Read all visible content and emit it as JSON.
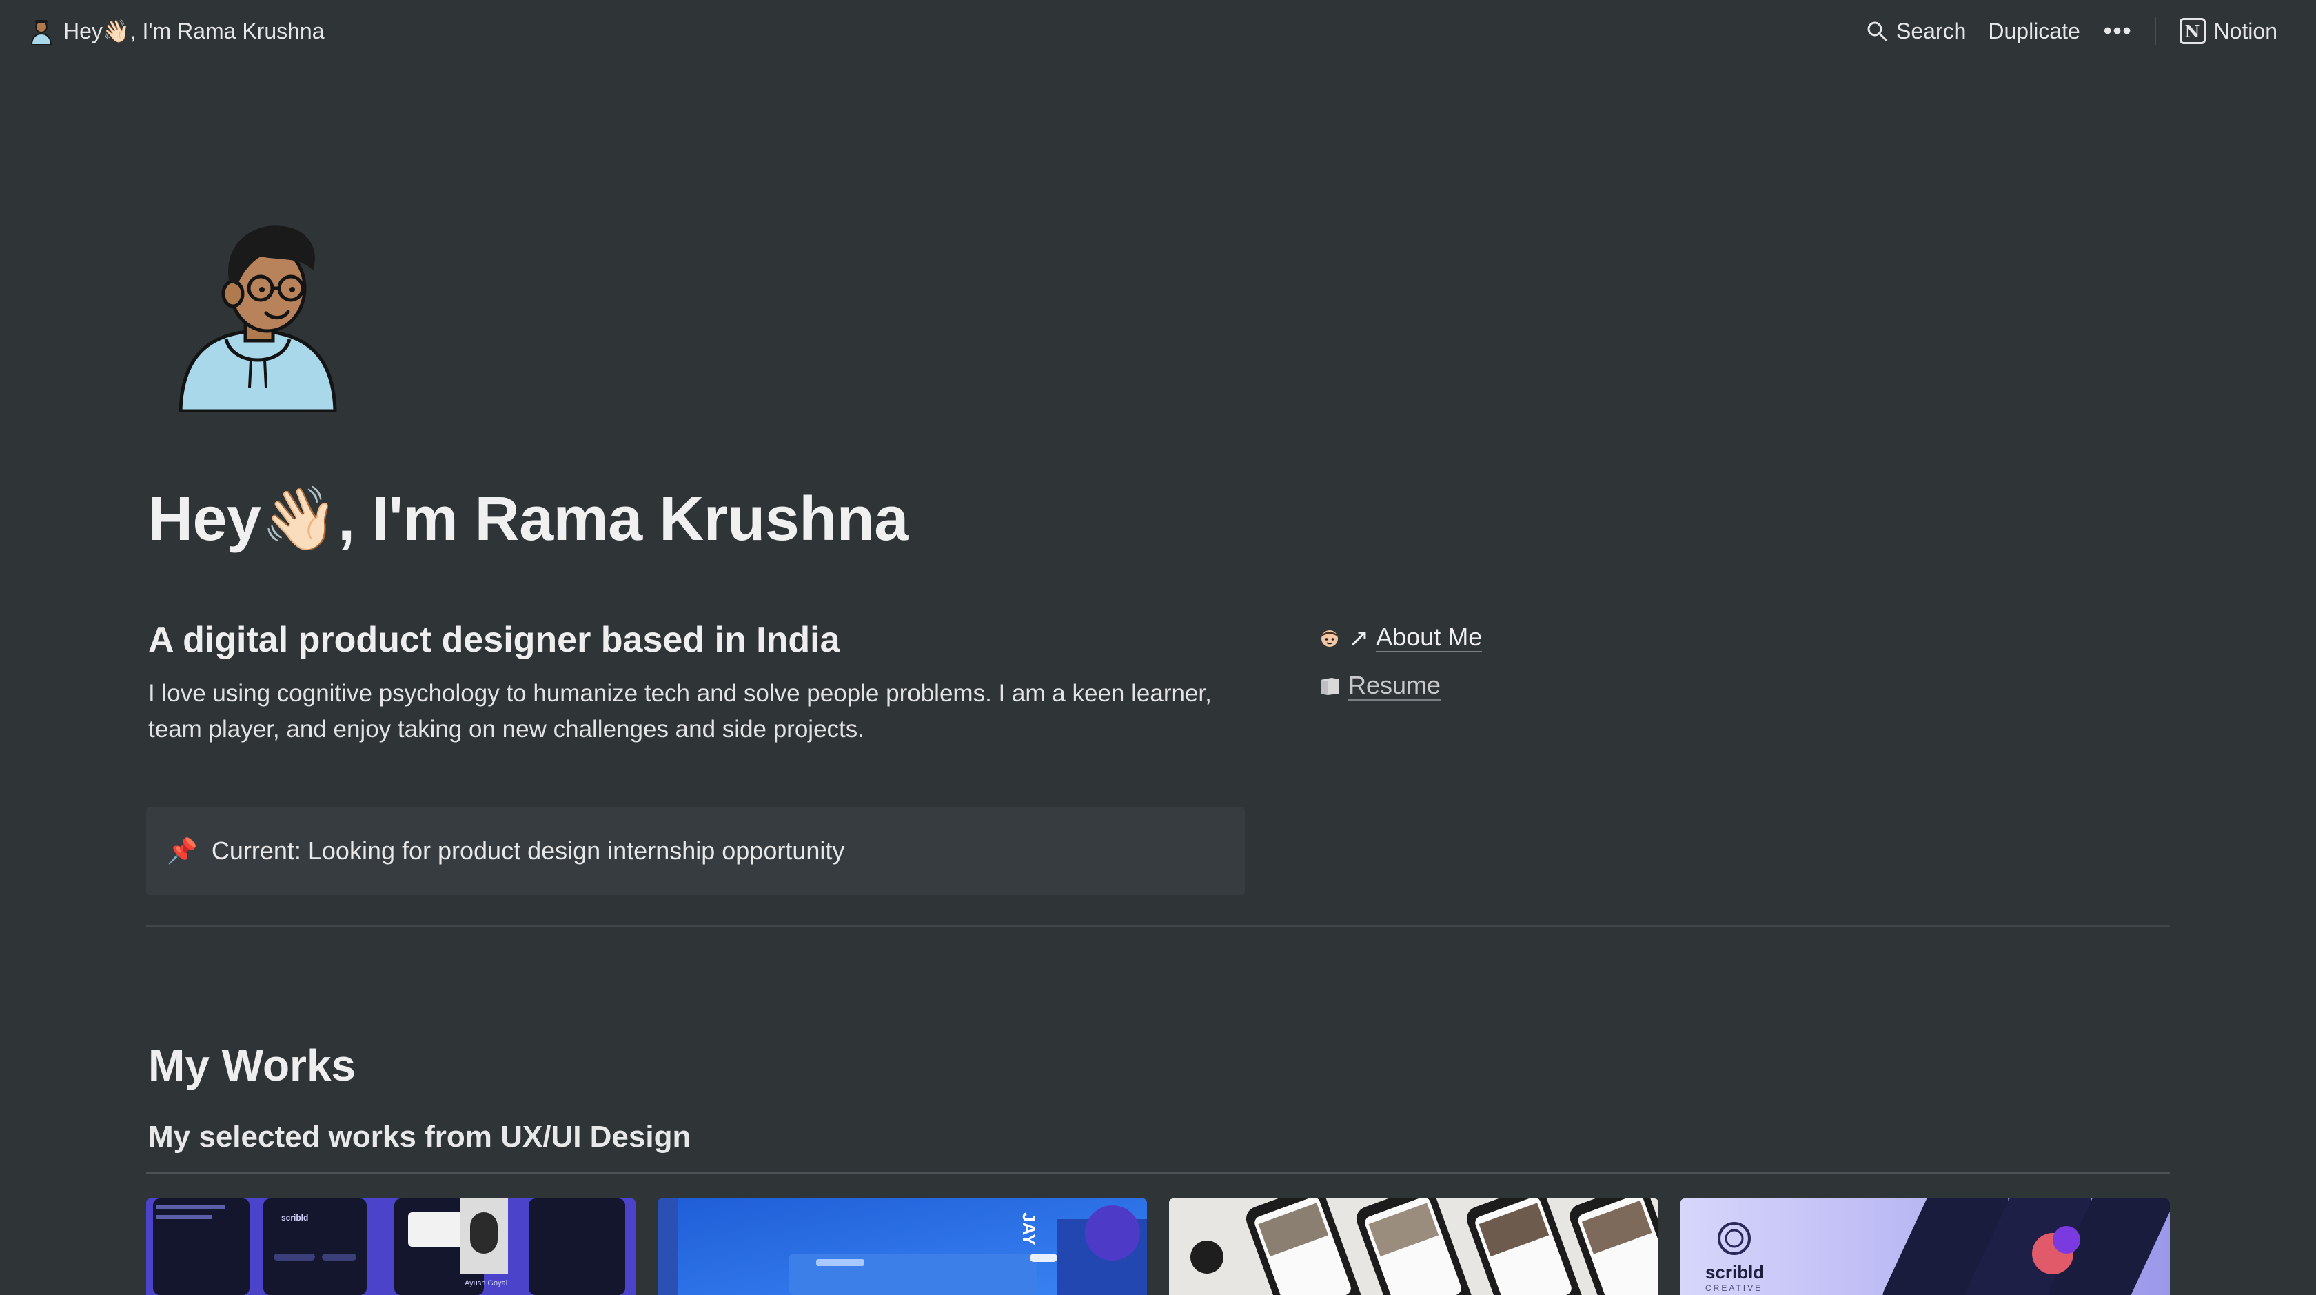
{
  "topbar": {
    "page_title": "Hey👋🏻, I'm Rama Krushna",
    "search_label": "Search",
    "duplicate_label": "Duplicate",
    "more_label": "•••",
    "notion_label": "Notion"
  },
  "page": {
    "title": "Hey👋🏻, I'm Rama Krushna",
    "headline": "A digital product designer based in India",
    "description": "I love using cognitive psychology to humanize tech and solve people problems. I am a keen learner, team player, and enjoy taking on new challenges and side projects.",
    "callout_icon": "📌",
    "callout_text": "Current: Looking for product design internship opportunity"
  },
  "links": {
    "about": {
      "arrow": "↗",
      "label": "About Me",
      "icon": "person-emoji-icon"
    },
    "resume": {
      "label": "Resume",
      "icon": "page-icon"
    }
  },
  "works": {
    "title": "My Works",
    "subtitle": "My selected works from UX/UI Design",
    "cards": [
      {
        "name": "work-card-1",
        "theme": "#4b43c9",
        "card_text": [
          "scribld",
          "Ayush Goyal"
        ]
      },
      {
        "name": "work-card-2",
        "theme": "#2d6fe0",
        "card_text": [
          "JAY"
        ]
      },
      {
        "name": "work-card-3",
        "theme": "#e8e6e2",
        "card_text": []
      },
      {
        "name": "work-card-4",
        "theme": "#b9b8f0",
        "card_text": [
          "scribld",
          "CREATIVE"
        ]
      }
    ]
  }
}
